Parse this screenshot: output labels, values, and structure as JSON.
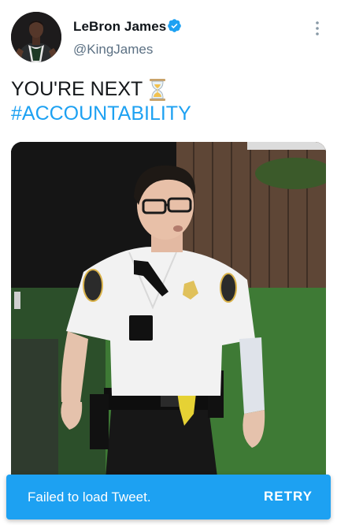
{
  "tweet": {
    "author": {
      "display_name": "LeBron James",
      "handle": "@KingJames",
      "verified": true,
      "avatar_icon": "avatar-photo"
    },
    "menu_icon": "more-vertical-icon",
    "text_line1": "YOU'RE NEXT",
    "text_emoji": "hourglass-icon",
    "hashtag": "#ACCOUNTABILITY",
    "media_icon": "video-still"
  },
  "toast": {
    "message": "Failed to load Tweet.",
    "action_label": "RETRY"
  },
  "colors": {
    "accent": "#1da1f2",
    "verified": "#1da1f2",
    "secondary_text": "#5b7083"
  }
}
